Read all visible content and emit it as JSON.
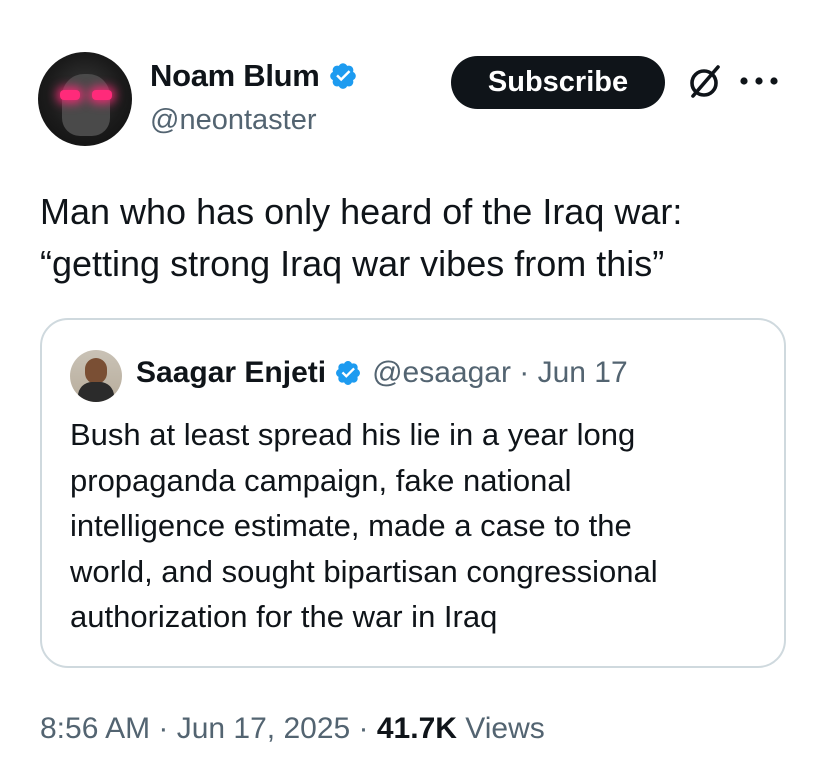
{
  "author": {
    "name": "Noam Blum",
    "handle": "@neontaster",
    "verified_color": "#1d9bf0"
  },
  "actions": {
    "subscribe_label": "Subscribe",
    "grok_icon": "grok-icon",
    "more_icon": "more-icon"
  },
  "tweet": {
    "lines": [
      "Man who has only heard of the Iraq war:",
      "“getting strong Iraq war vibes from this”"
    ]
  },
  "quote": {
    "name": "Saagar Enjeti",
    "meta": "@esaagar · Jun 17",
    "lines": [
      "Bush at least spread his lie in a year long",
      "propaganda campaign, fake national",
      "intelligence estimate, made a case to the",
      "world, and sought bipartisan congressional",
      "authorization for the war in Iraq"
    ]
  },
  "footer": {
    "timestamp": "8:56 AM · Jun 17, 2025 · ",
    "views_count": "41.7K",
    "views_label": " Views"
  },
  "colors": {
    "text": "#0f1419",
    "secondary": "#536471",
    "border": "#cfd9de",
    "button_bg": "#0f1419"
  }
}
